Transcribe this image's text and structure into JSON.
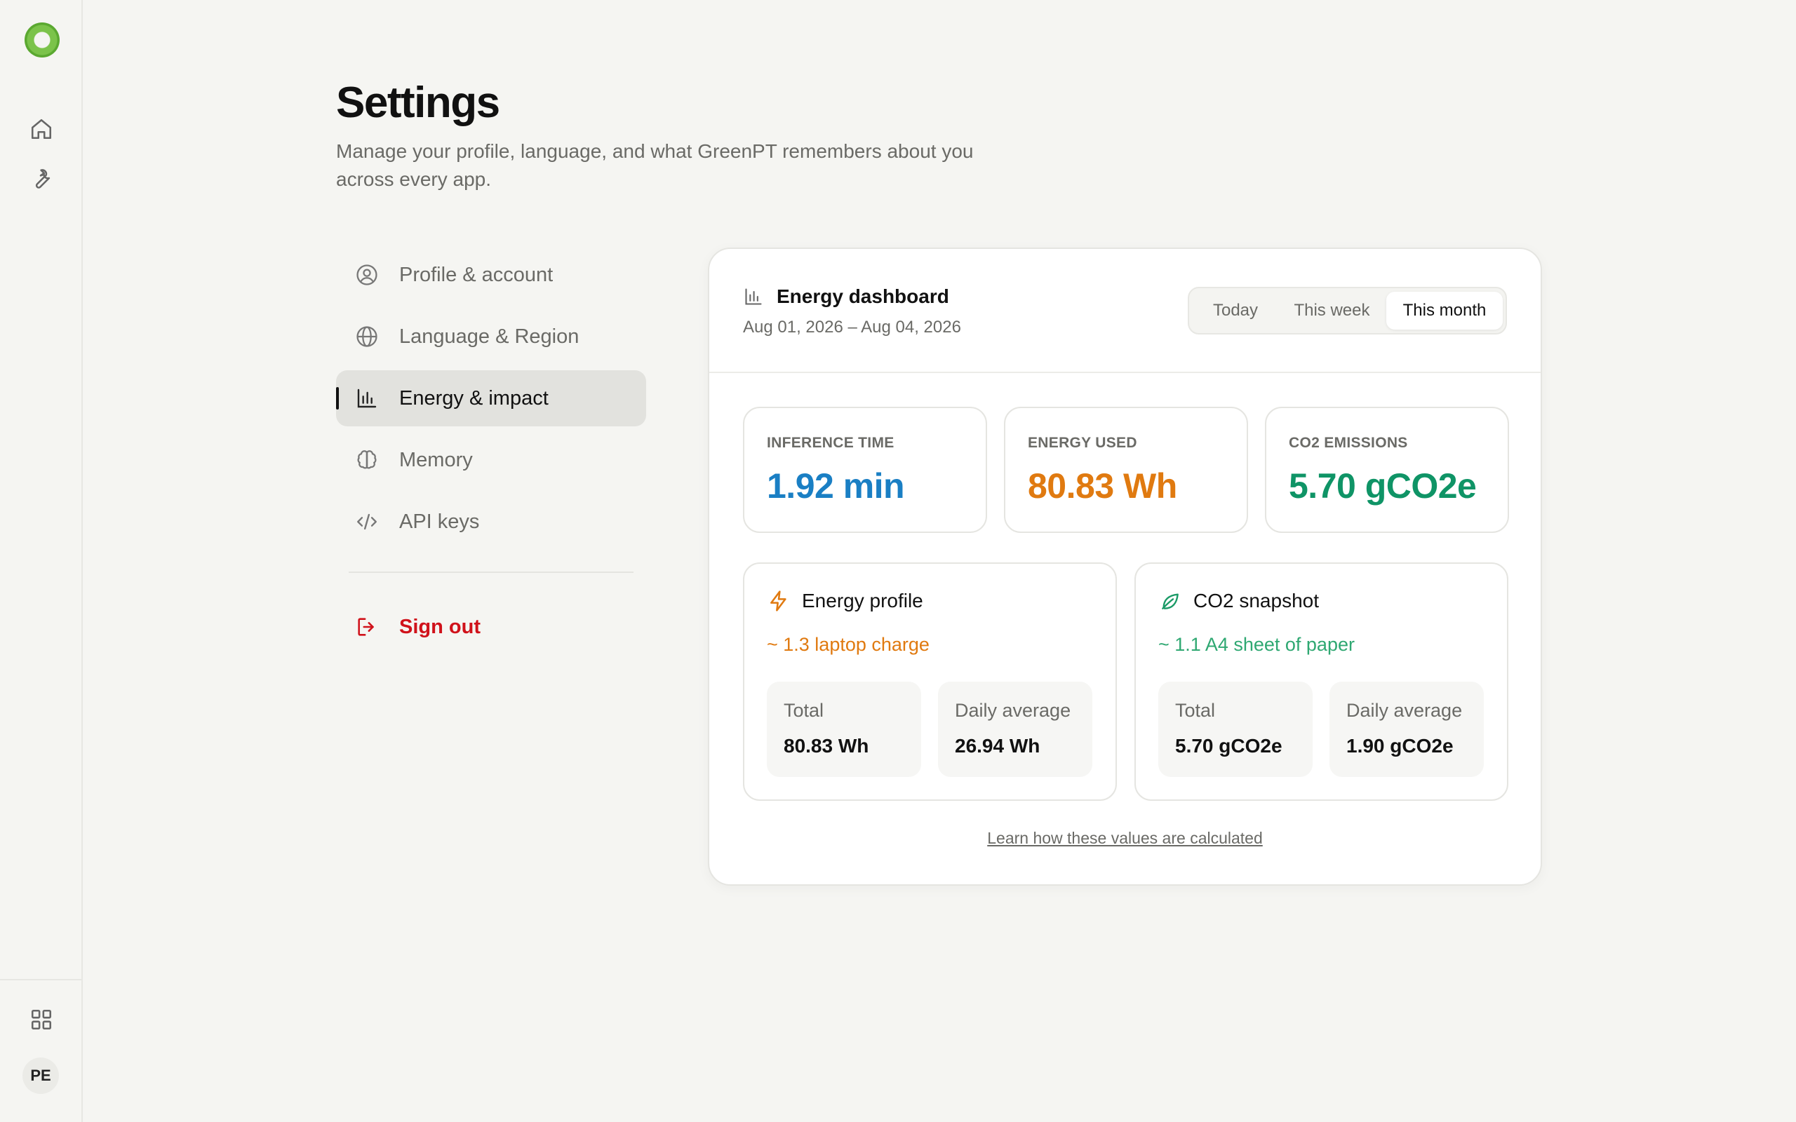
{
  "sidebar_rail": {
    "avatar_initials": "PE"
  },
  "header": {
    "title": "Settings",
    "subtitle": "Manage your profile, language, and what GreenPT remembers about you across every app."
  },
  "nav": {
    "items": [
      {
        "label": "Profile & account",
        "icon": "user-circle-icon"
      },
      {
        "label": "Language & Region",
        "icon": "globe-icon"
      },
      {
        "label": "Energy & impact",
        "icon": "bar-chart-icon",
        "active": true
      },
      {
        "label": "Memory",
        "icon": "brain-icon"
      },
      {
        "label": "API keys",
        "icon": "code-icon"
      }
    ],
    "sign_out": "Sign out"
  },
  "dashboard": {
    "title": "Energy dashboard",
    "date_range": "Aug 01, 2026 – Aug 04, 2026",
    "periods": [
      "Today",
      "This week",
      "This month"
    ],
    "selected_period": "This month",
    "stats": [
      {
        "label": "INFERENCE TIME",
        "value": "1.92 min",
        "color": "#1a7fc4"
      },
      {
        "label": "ENERGY USED",
        "value": "80.83 Wh",
        "color": "#e07a10"
      },
      {
        "label": "CO2 EMISSIONS",
        "value": "5.70 gCO2e",
        "color": "#0f9466"
      }
    ],
    "energy_profile": {
      "title": "Energy profile",
      "equivalent": "~ 1.3 laptop charge",
      "equivalent_color": "#e07a10",
      "total_label": "Total",
      "total_value": "80.83 Wh",
      "avg_label": "Daily average",
      "avg_value": "26.94 Wh"
    },
    "co2_snapshot": {
      "title": "CO2 snapshot",
      "equivalent": "~ 1.1 A4 sheet of paper",
      "equivalent_color": "#2fa872",
      "total_label": "Total",
      "total_value": "5.70 gCO2e",
      "avg_label": "Daily average",
      "avg_value": "1.90 gCO2e"
    },
    "learn_link": "Learn how these values are calculated"
  }
}
